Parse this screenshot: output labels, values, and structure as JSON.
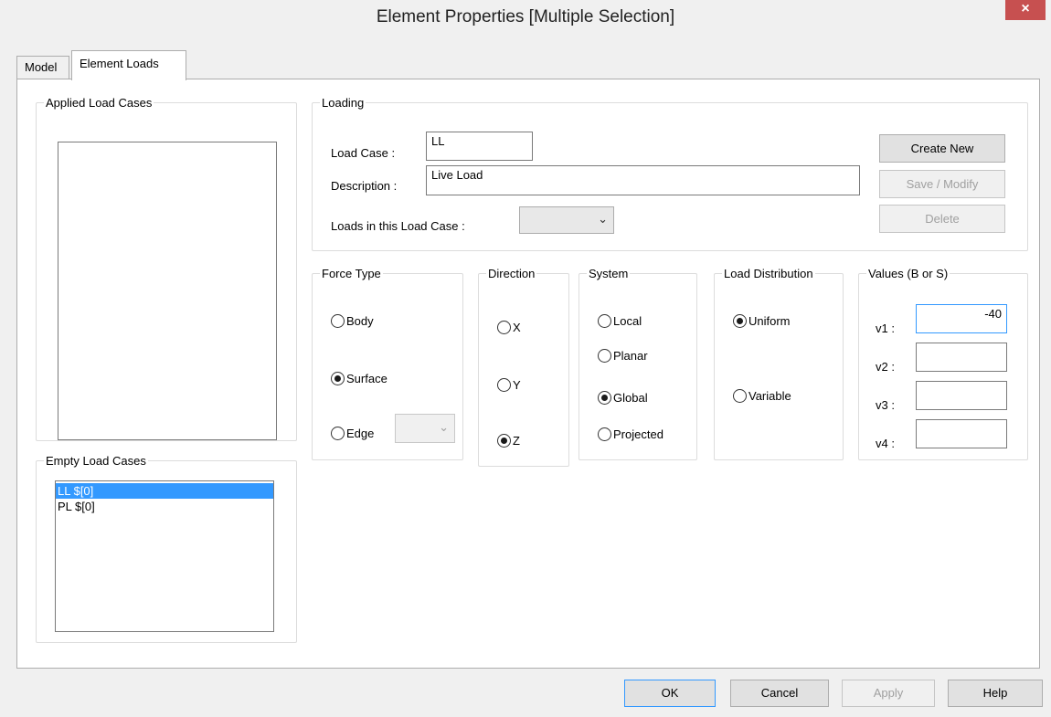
{
  "window": {
    "title": "Element Properties [Multiple Selection]",
    "close_glyph": "×"
  },
  "tabs": [
    {
      "label": "Model"
    },
    {
      "label": "Element Loads"
    }
  ],
  "applied": {
    "legend": "Applied Load Cases"
  },
  "empty": {
    "legend": "Empty Load Cases",
    "items": [
      "LL $[0]",
      "PL $[0]"
    ],
    "selected_index": 0
  },
  "loading": {
    "legend": "Loading",
    "load_case_label": "Load Case :",
    "load_case_value": "LL",
    "description_label": "Description :",
    "description_value": "Live Load",
    "loads_label": "Loads in this Load Case :",
    "loads_value": "",
    "create_new": "Create New",
    "save_modify": "Save / Modify",
    "delete": "Delete"
  },
  "force_type": {
    "legend": "Force Type",
    "options": [
      "Body",
      "Surface",
      "Edge"
    ],
    "selected": "Surface",
    "edge_value": ""
  },
  "direction": {
    "legend": "Direction",
    "options": [
      "X",
      "Y",
      "Z"
    ],
    "selected": "Z"
  },
  "system": {
    "legend": "System",
    "options": [
      "Local",
      "Planar",
      "Global",
      "Projected"
    ],
    "selected": "Global"
  },
  "distribution": {
    "legend": "Load Distribution",
    "options": [
      "Uniform",
      "Variable"
    ],
    "selected": "Uniform"
  },
  "values": {
    "legend": "Values (B or S)",
    "v1_label": "v1 :",
    "v1": "-40",
    "v2_label": "v2 :",
    "v2": "",
    "v3_label": "v3 :",
    "v3": "",
    "v4_label": "v4 :",
    "v4": ""
  },
  "footer": {
    "ok": "OK",
    "cancel": "Cancel",
    "apply": "Apply",
    "help": "Help"
  },
  "icons": {
    "dropdown": "chevron-down-icon",
    "close": "close-icon"
  },
  "colors": {
    "selection": "#3399ff",
    "close_button": "#c75050",
    "focus_border": "#3399ff"
  }
}
